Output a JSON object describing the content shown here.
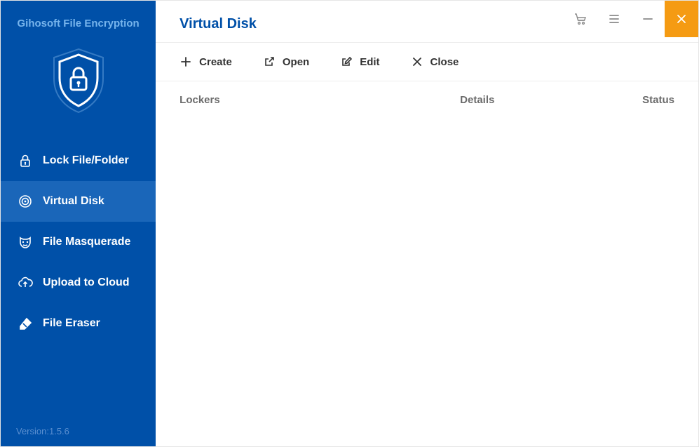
{
  "brand": "Gihosoft File Encryption",
  "version_label": "Version:1.5.6",
  "sidebar": {
    "items": [
      {
        "label": "Lock File/Folder"
      },
      {
        "label": "Virtual Disk"
      },
      {
        "label": "File Masquerade"
      },
      {
        "label": "Upload to Cloud"
      },
      {
        "label": "File Eraser"
      }
    ]
  },
  "page_title": "Virtual Disk",
  "toolbar": {
    "create": "Create",
    "open": "Open",
    "edit": "Edit",
    "close": "Close"
  },
  "columns": {
    "lockers": "Lockers",
    "details": "Details",
    "status": "Status"
  }
}
